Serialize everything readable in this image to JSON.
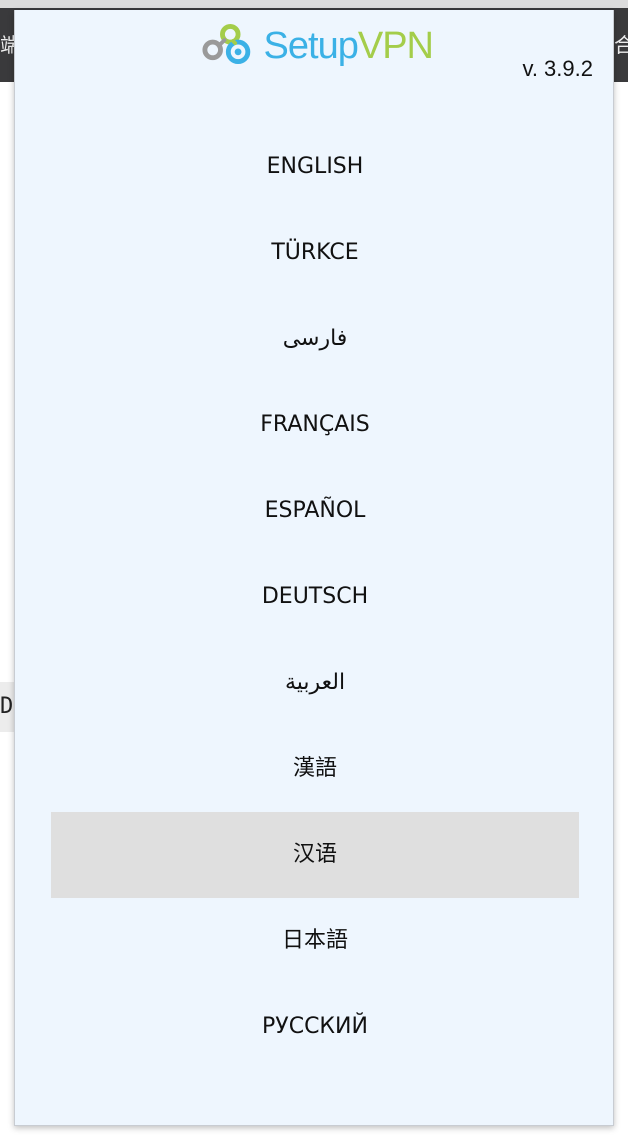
{
  "header": {
    "logo_setup": "Setup",
    "logo_vpn": "VPN",
    "version": "v. 3.9.2"
  },
  "languages": [
    {
      "label": "ENGLISH"
    },
    {
      "label": "TÜRKCE"
    },
    {
      "label": "فارسی"
    },
    {
      "label": "FRANÇAIS"
    },
    {
      "label": "ESPAÑOL"
    },
    {
      "label": "DEUTSCH"
    },
    {
      "label": "العربية"
    },
    {
      "label": "漢語"
    },
    {
      "label": "汉语",
      "highlighted": true
    },
    {
      "label": "日本語"
    },
    {
      "label": "РУССКИЙ"
    }
  ],
  "background": {
    "left_fragment": "端",
    "right_fragment": "合",
    "tab_letter": "D"
  },
  "colors": {
    "popup_bg": "#eef6fe",
    "highlight_bg": "#dfdfdf",
    "logo_blue": "#3bb1e6",
    "logo_green": "#a4cd4a",
    "logo_gray": "#9a9a9a"
  },
  "icons": {
    "logo_mark": "setupvpn-logo-icon"
  }
}
